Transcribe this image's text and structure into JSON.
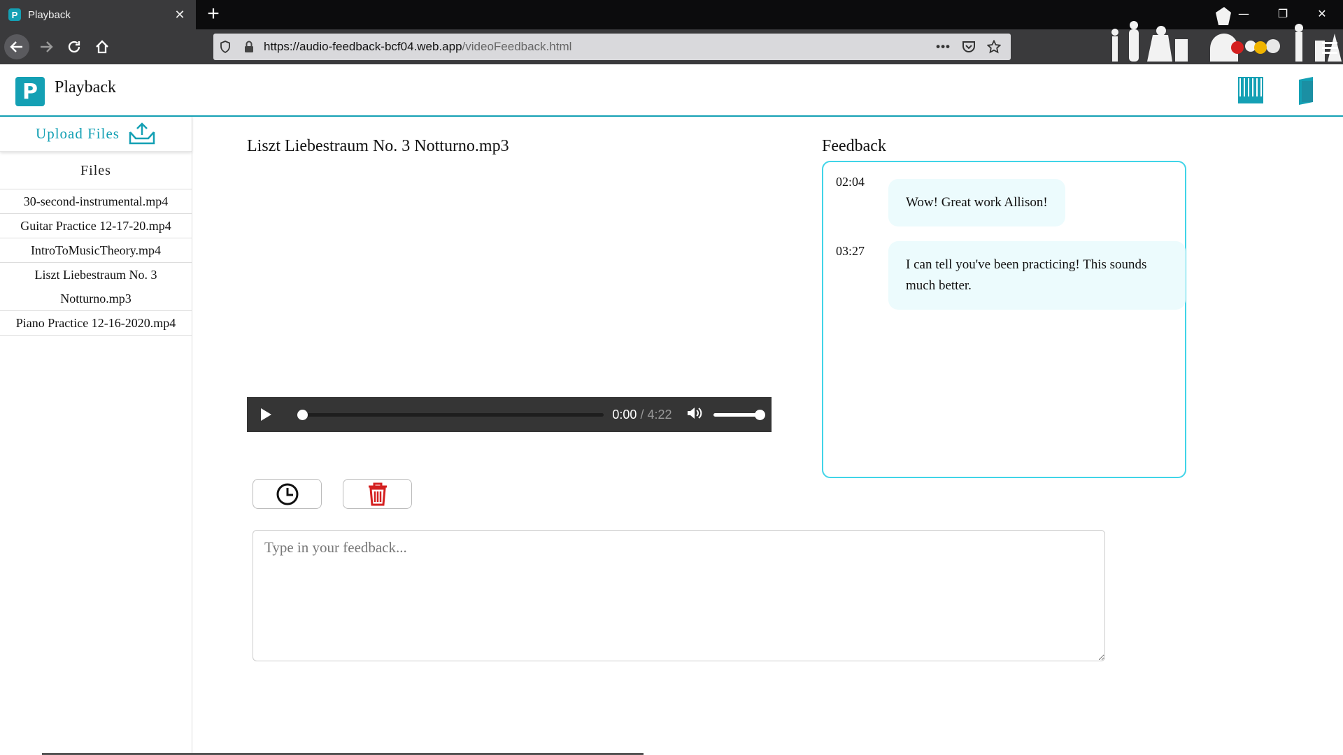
{
  "browser": {
    "tab_title": "Playback",
    "tab_favicon": "P",
    "url_main": "https://audio-feedback-bcf04.web.app",
    "url_path": "/videoFeedback.html",
    "icons": [
      "back-arrow-icon",
      "forward-arrow-icon",
      "reload-icon",
      "home-icon",
      "shield-icon",
      "lock-icon",
      "more-icon",
      "pocket-icon",
      "star-icon",
      "menu-icon"
    ]
  },
  "header": {
    "logo_letter": "P",
    "title": "Playback",
    "accent_color": "#14a0b4",
    "icons": [
      "piano-keys-icon",
      "notebook-icon"
    ]
  },
  "sidebar": {
    "upload_label": "Upload Files",
    "files_heading": "Files",
    "files": [
      "30-second-instrumental.mp4",
      "Guitar Practice 12-17-20.mp4",
      "IntroToMusicTheory.mp4",
      "Liszt Liebestraum No. 3 Notturno.mp3",
      "Piano Practice 12-16-2020.mp4"
    ]
  },
  "main": {
    "media_title": "Liszt Liebestraum No. 3 Notturno.mp3",
    "player": {
      "current_time": "0:00",
      "duration": "/ 4:22",
      "progress": 0,
      "volume": 1.0
    },
    "feedback_placeholder": "Type in your feedback...",
    "tool_icons": [
      "clock-icon",
      "trash-icon"
    ],
    "delete_color": "#d42020"
  },
  "feedback": {
    "heading": "Feedback",
    "border_color": "#40d4e8",
    "entries": [
      {
        "time": "02:04",
        "text": "Wow! Great work Allison!"
      },
      {
        "time": "03:27",
        "text": "I can tell you've been practicing! This sounds much better."
      }
    ]
  }
}
